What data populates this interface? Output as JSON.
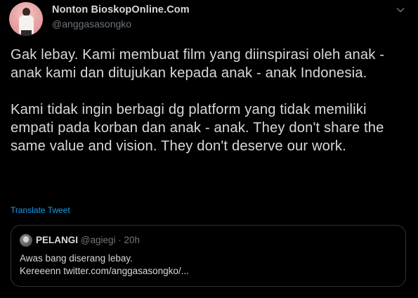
{
  "header": {
    "display_name": "Nonton BioskopOnline.Com",
    "handle": "@anggasasongko",
    "more_glyph": "⌄",
    "more_icon": "chevron-down-icon"
  },
  "tweet": {
    "text": "Gak lebay. Kami membuat film yang diinspirasi oleh anak - anak kami dan ditujukan kepada anak - anak Indonesia.\n\nKami tidak ingin berbagi dg platform yang tidak memiliki empati pada korban dan anak - anak. They don't share the same value and vision. They don't deserve our work.",
    "translate_label": "Translate Tweet"
  },
  "quote": {
    "name": "PELANGI",
    "handle": "@agiegi",
    "separator": " · ",
    "time": "20h",
    "line1": "Awas bang diserang lebay.",
    "line2": "Kereeenn twitter.com/anggasasongko/..."
  },
  "colors": {
    "background": "#000000",
    "text": "#d9d9d9",
    "muted": "#6e767d",
    "link": "#1d9bf0",
    "border": "#2f3336"
  }
}
